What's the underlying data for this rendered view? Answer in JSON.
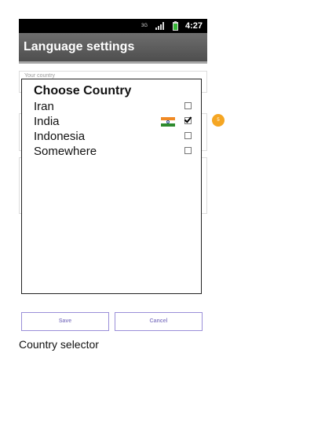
{
  "status_bar": {
    "network_label": "3G",
    "time": "4:27"
  },
  "app": {
    "title": "Language settings"
  },
  "background_form": {
    "country_label": "Your country"
  },
  "dialog": {
    "title": "Choose Country",
    "options": [
      {
        "label": "Iran",
        "checked": false
      },
      {
        "label": "India",
        "checked": true,
        "flag": "india-flag"
      },
      {
        "label": "Indonesia",
        "checked": false
      },
      {
        "label": "Somewhere",
        "checked": false
      }
    ]
  },
  "annotation_badge": "5",
  "buttons": {
    "save_label": "Save",
    "cancel_label": "Cancel"
  },
  "caption": "Country selector",
  "colors": {
    "titlebar": "#5e5e5e",
    "button_border": "#9a8fd8",
    "badge": "#f5a623"
  }
}
